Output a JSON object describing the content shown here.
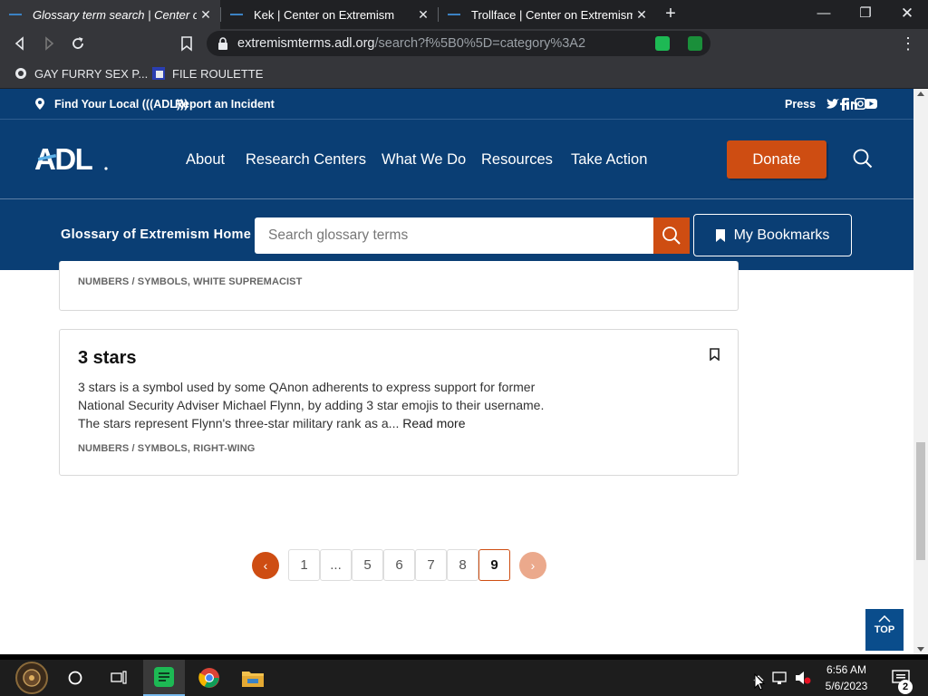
{
  "browser": {
    "tabs": [
      {
        "title": "Glossary term search | Center o",
        "active": true
      },
      {
        "title": "Kek | Center on Extremism",
        "active": false
      },
      {
        "title": "Trollface | Center on Extremism",
        "active": false
      }
    ],
    "url_domain": "extremismterms.adl.org",
    "url_path": "/search?f%5B0%5D=category%3A2",
    "bookmarks": [
      {
        "label": "GAY FURRY SEX P..."
      },
      {
        "label": "FILE ROULETTE"
      }
    ],
    "extension_badge": "1"
  },
  "site": {
    "top_links": {
      "find_local": "Find Your Local (((ADL)))",
      "report": "Report an Incident",
      "press": "Press"
    },
    "logo": "ADL",
    "nav": [
      "About",
      "Research Centers",
      "What We Do",
      "Resources",
      "Take Action"
    ],
    "donate": "Donate",
    "glossary_home": "Glossary of Extremism Home",
    "search_placeholder": "Search glossary terms",
    "my_bookmarks": "My Bookmarks"
  },
  "results": {
    "prev_card_categories": "NUMBERS / SYMBOLS, WHITE SUPREMACIST",
    "card": {
      "title": "3 stars",
      "description": "3 stars is a symbol used by some QAnon adherents to express support for former National Security Adviser Michael Flynn, by adding 3 star emojis to their username. The stars represent Flynn's three-star military rank as a...",
      "read_more": "Read more",
      "categories": "NUMBERS / SYMBOLS, RIGHT-WING"
    }
  },
  "pagination": {
    "pages": [
      "1",
      "...",
      "5",
      "6",
      "7",
      "8",
      "9"
    ],
    "current": "9"
  },
  "top_button": "TOP",
  "taskbar": {
    "time": "6:56 AM",
    "date": "5/6/2023",
    "notification_count": "2"
  },
  "colors": {
    "adl_navy": "#0a3e74",
    "adl_orange": "#ce4d12",
    "browser_dark": "#202124",
    "browser_toolbar": "#35363a"
  }
}
